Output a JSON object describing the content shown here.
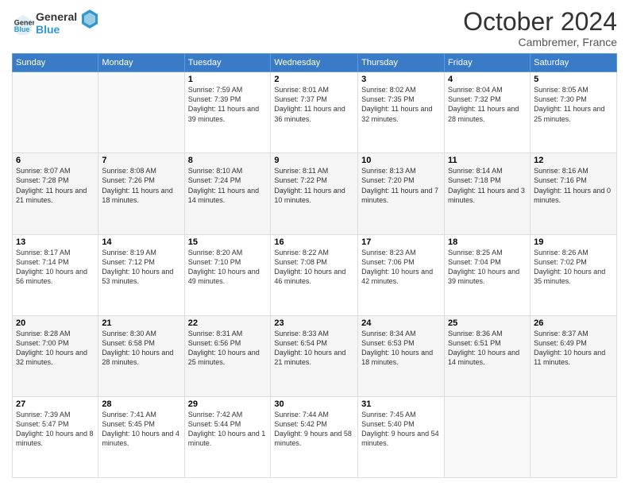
{
  "logo": {
    "line1": "General",
    "line2": "Blue"
  },
  "title": "October 2024",
  "location": "Cambremer, France",
  "days_header": [
    "Sunday",
    "Monday",
    "Tuesday",
    "Wednesday",
    "Thursday",
    "Friday",
    "Saturday"
  ],
  "weeks": [
    [
      {
        "day": "",
        "info": ""
      },
      {
        "day": "",
        "info": ""
      },
      {
        "day": "1",
        "info": "Sunrise: 7:59 AM\nSunset: 7:39 PM\nDaylight: 11 hours and 39 minutes."
      },
      {
        "day": "2",
        "info": "Sunrise: 8:01 AM\nSunset: 7:37 PM\nDaylight: 11 hours and 36 minutes."
      },
      {
        "day": "3",
        "info": "Sunrise: 8:02 AM\nSunset: 7:35 PM\nDaylight: 11 hours and 32 minutes."
      },
      {
        "day": "4",
        "info": "Sunrise: 8:04 AM\nSunset: 7:32 PM\nDaylight: 11 hours and 28 minutes."
      },
      {
        "day": "5",
        "info": "Sunrise: 8:05 AM\nSunset: 7:30 PM\nDaylight: 11 hours and 25 minutes."
      }
    ],
    [
      {
        "day": "6",
        "info": "Sunrise: 8:07 AM\nSunset: 7:28 PM\nDaylight: 11 hours and 21 minutes."
      },
      {
        "day": "7",
        "info": "Sunrise: 8:08 AM\nSunset: 7:26 PM\nDaylight: 11 hours and 18 minutes."
      },
      {
        "day": "8",
        "info": "Sunrise: 8:10 AM\nSunset: 7:24 PM\nDaylight: 11 hours and 14 minutes."
      },
      {
        "day": "9",
        "info": "Sunrise: 8:11 AM\nSunset: 7:22 PM\nDaylight: 11 hours and 10 minutes."
      },
      {
        "day": "10",
        "info": "Sunrise: 8:13 AM\nSunset: 7:20 PM\nDaylight: 11 hours and 7 minutes."
      },
      {
        "day": "11",
        "info": "Sunrise: 8:14 AM\nSunset: 7:18 PM\nDaylight: 11 hours and 3 minutes."
      },
      {
        "day": "12",
        "info": "Sunrise: 8:16 AM\nSunset: 7:16 PM\nDaylight: 11 hours and 0 minutes."
      }
    ],
    [
      {
        "day": "13",
        "info": "Sunrise: 8:17 AM\nSunset: 7:14 PM\nDaylight: 10 hours and 56 minutes."
      },
      {
        "day": "14",
        "info": "Sunrise: 8:19 AM\nSunset: 7:12 PM\nDaylight: 10 hours and 53 minutes."
      },
      {
        "day": "15",
        "info": "Sunrise: 8:20 AM\nSunset: 7:10 PM\nDaylight: 10 hours and 49 minutes."
      },
      {
        "day": "16",
        "info": "Sunrise: 8:22 AM\nSunset: 7:08 PM\nDaylight: 10 hours and 46 minutes."
      },
      {
        "day": "17",
        "info": "Sunrise: 8:23 AM\nSunset: 7:06 PM\nDaylight: 10 hours and 42 minutes."
      },
      {
        "day": "18",
        "info": "Sunrise: 8:25 AM\nSunset: 7:04 PM\nDaylight: 10 hours and 39 minutes."
      },
      {
        "day": "19",
        "info": "Sunrise: 8:26 AM\nSunset: 7:02 PM\nDaylight: 10 hours and 35 minutes."
      }
    ],
    [
      {
        "day": "20",
        "info": "Sunrise: 8:28 AM\nSunset: 7:00 PM\nDaylight: 10 hours and 32 minutes."
      },
      {
        "day": "21",
        "info": "Sunrise: 8:30 AM\nSunset: 6:58 PM\nDaylight: 10 hours and 28 minutes."
      },
      {
        "day": "22",
        "info": "Sunrise: 8:31 AM\nSunset: 6:56 PM\nDaylight: 10 hours and 25 minutes."
      },
      {
        "day": "23",
        "info": "Sunrise: 8:33 AM\nSunset: 6:54 PM\nDaylight: 10 hours and 21 minutes."
      },
      {
        "day": "24",
        "info": "Sunrise: 8:34 AM\nSunset: 6:53 PM\nDaylight: 10 hours and 18 minutes."
      },
      {
        "day": "25",
        "info": "Sunrise: 8:36 AM\nSunset: 6:51 PM\nDaylight: 10 hours and 14 minutes."
      },
      {
        "day": "26",
        "info": "Sunrise: 8:37 AM\nSunset: 6:49 PM\nDaylight: 10 hours and 11 minutes."
      }
    ],
    [
      {
        "day": "27",
        "info": "Sunrise: 7:39 AM\nSunset: 5:47 PM\nDaylight: 10 hours and 8 minutes."
      },
      {
        "day": "28",
        "info": "Sunrise: 7:41 AM\nSunset: 5:45 PM\nDaylight: 10 hours and 4 minutes."
      },
      {
        "day": "29",
        "info": "Sunrise: 7:42 AM\nSunset: 5:44 PM\nDaylight: 10 hours and 1 minute."
      },
      {
        "day": "30",
        "info": "Sunrise: 7:44 AM\nSunset: 5:42 PM\nDaylight: 9 hours and 58 minutes."
      },
      {
        "day": "31",
        "info": "Sunrise: 7:45 AM\nSunset: 5:40 PM\nDaylight: 9 hours and 54 minutes."
      },
      {
        "day": "",
        "info": ""
      },
      {
        "day": "",
        "info": ""
      }
    ]
  ]
}
